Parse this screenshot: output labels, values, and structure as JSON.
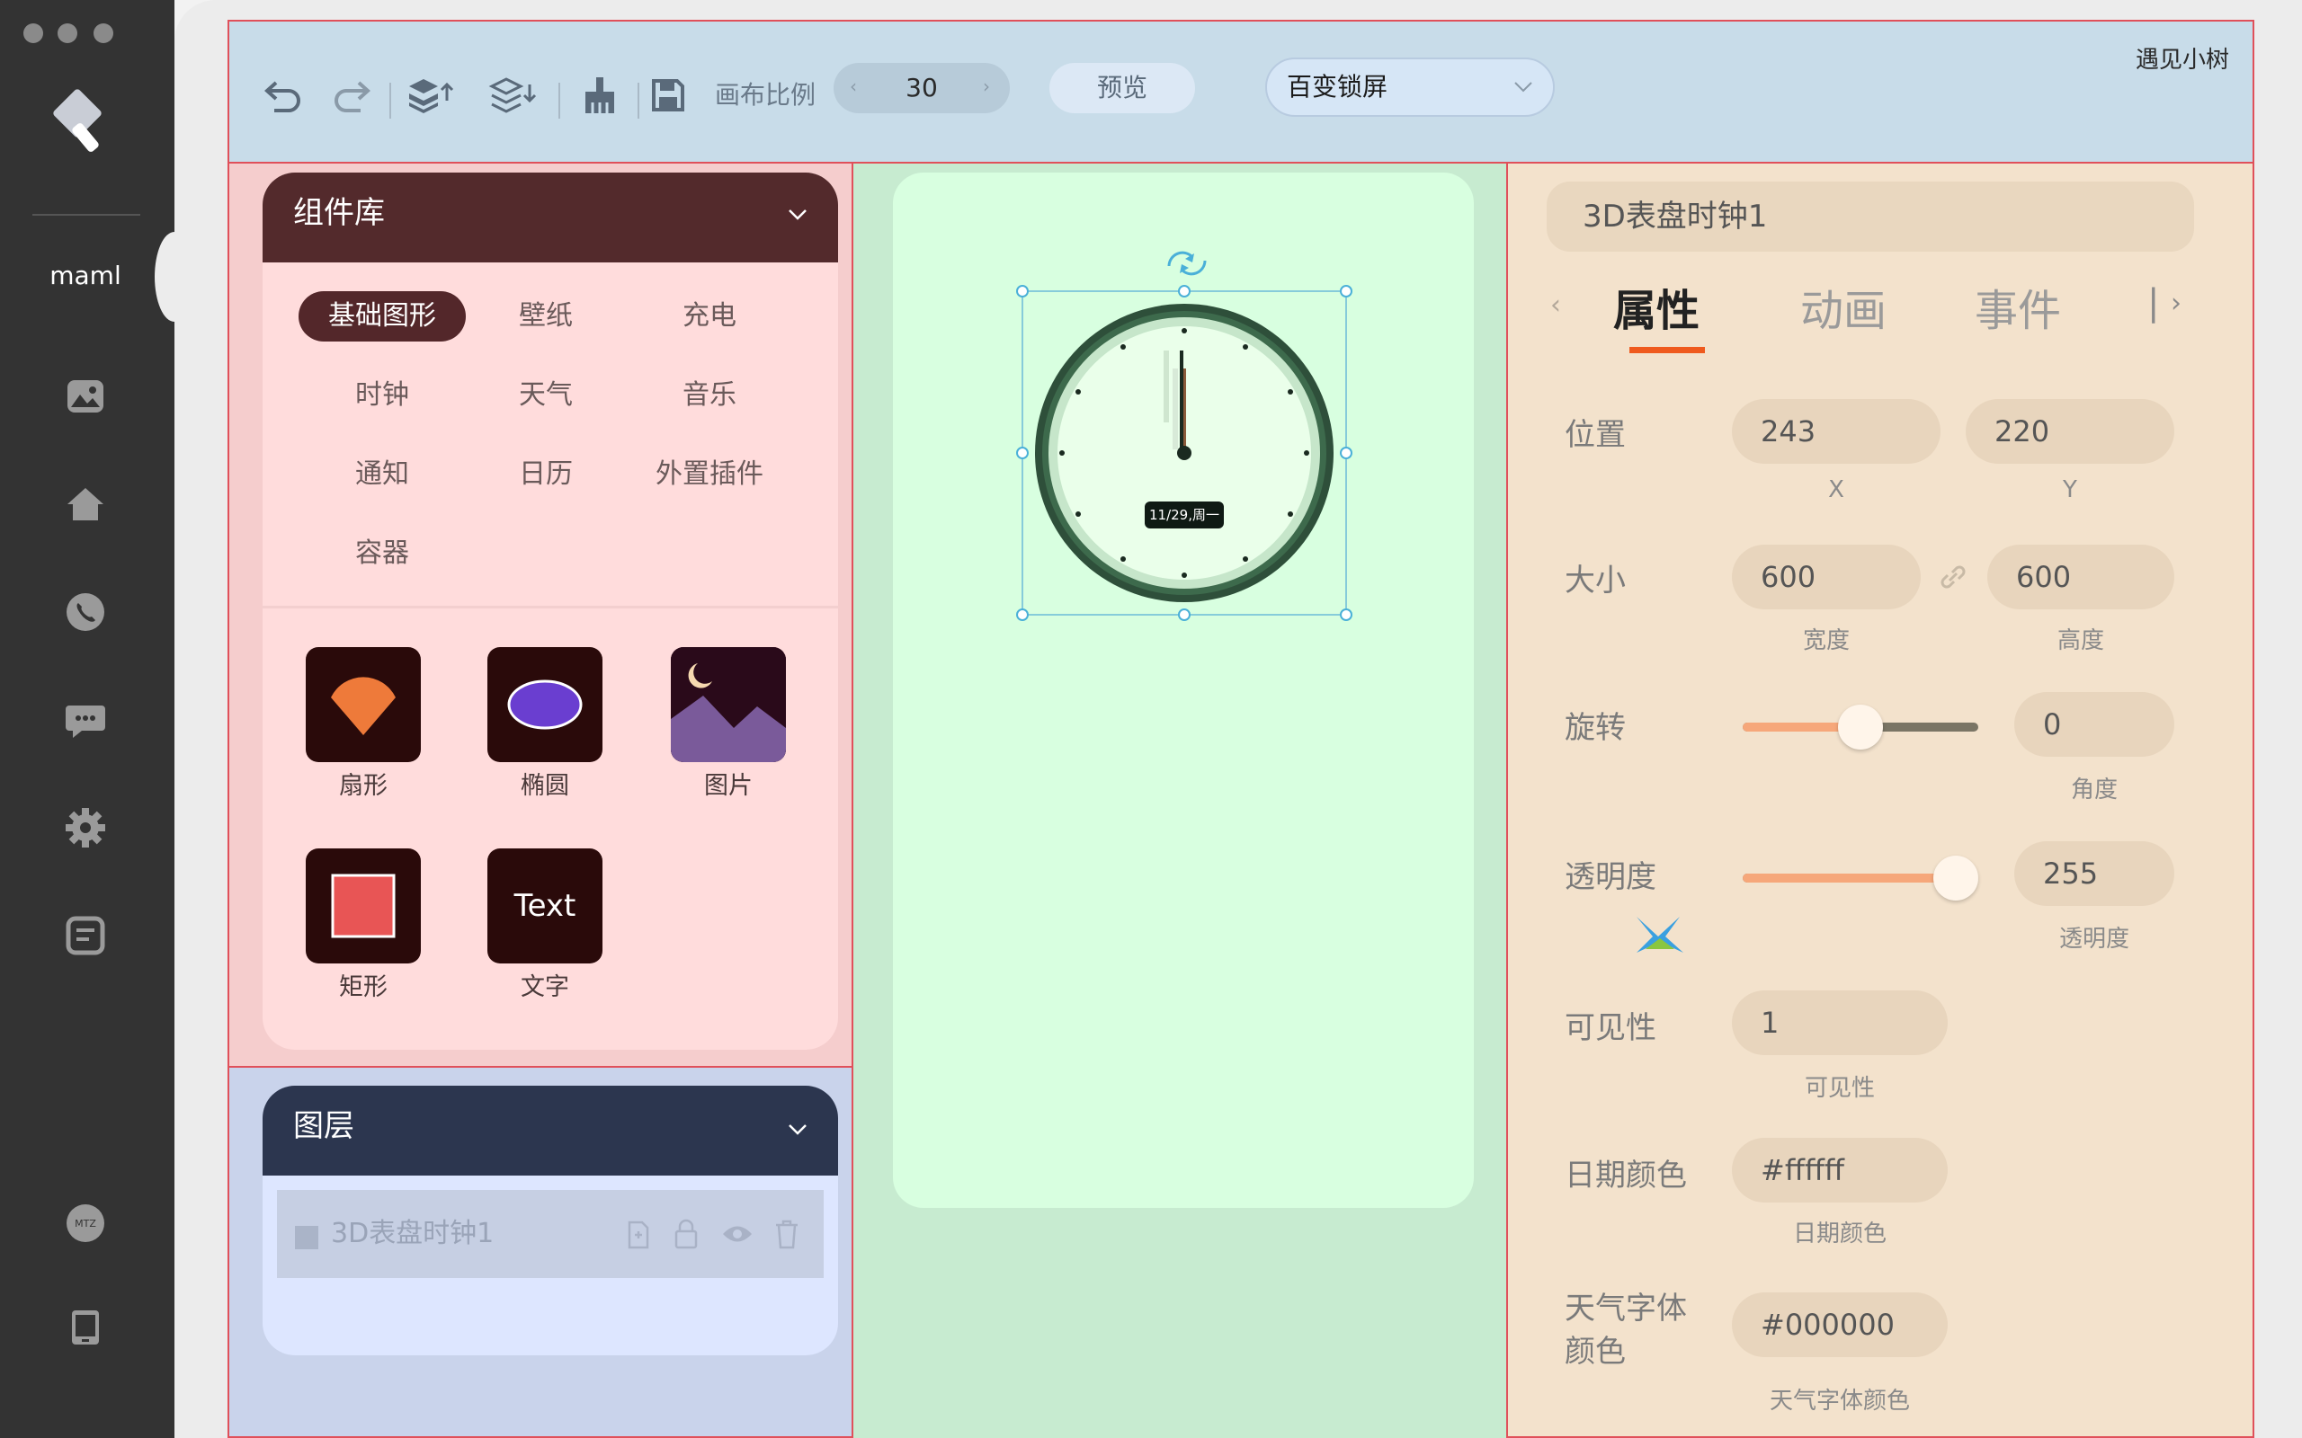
{
  "app": {
    "sidebar_label": "maml",
    "user": "遇见小树"
  },
  "toolbar": {
    "canvas_ratio_label": "画布比例",
    "canvas_ratio_value": "30",
    "preview_label": "预览",
    "template_select": "百变锁屏"
  },
  "library": {
    "title": "组件库",
    "categories": [
      "基础图形",
      "壁纸",
      "充电",
      "时钟",
      "天气",
      "音乐",
      "通知",
      "日历",
      "外置插件",
      "容器"
    ],
    "active_category": "基础图形",
    "components": [
      {
        "label": "扇形",
        "icon": "sector-icon"
      },
      {
        "label": "椭圆",
        "icon": "ellipse-icon"
      },
      {
        "label": "图片",
        "icon": "image-icon"
      },
      {
        "label": "矩形",
        "icon": "rectangle-icon"
      },
      {
        "label": "文字",
        "icon": "text-icon",
        "tile_text": "Text"
      }
    ]
  },
  "layers": {
    "title": "图层",
    "items": [
      {
        "name": "3D表盘时钟1"
      }
    ]
  },
  "canvas": {
    "clock_date_label": "11/29,周一"
  },
  "props": {
    "component_name": "3D表盘时钟1",
    "tabs": [
      "属性",
      "动画",
      "事件"
    ],
    "active_tab": "属性",
    "position": {
      "label": "位置",
      "x": "243",
      "y": "220",
      "x_sub": "X",
      "y_sub": "Y"
    },
    "size": {
      "label": "大小",
      "width": "600",
      "height": "600",
      "width_sub": "宽度",
      "height_sub": "高度"
    },
    "rotation": {
      "label": "旋转",
      "value": "0",
      "sub": "角度",
      "slider_fraction": 0.5
    },
    "opacity": {
      "label": "透明度",
      "value": "255",
      "sub": "透明度",
      "slider_fraction": 1.0
    },
    "visibility": {
      "label": "可见性",
      "value": "1",
      "sub": "可见性"
    },
    "date_color": {
      "label": "日期颜色",
      "value": "#ffffff",
      "sub": "日期颜色"
    },
    "weather_font_color": {
      "label": "天气字体颜色",
      "label_line1": "天气字体",
      "label_line2": "颜色",
      "value": "#000000",
      "sub": "天气字体颜色"
    }
  },
  "colors": {
    "accent": "#ef5a1e",
    "library_header": "#532a2c",
    "layers_header": "#2c364f",
    "sidebar": "#333333"
  }
}
